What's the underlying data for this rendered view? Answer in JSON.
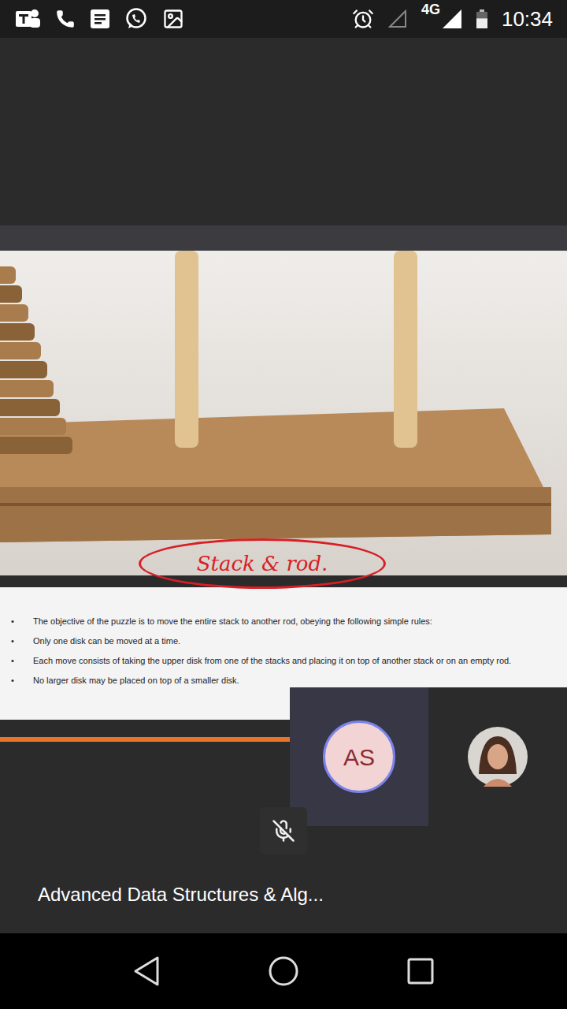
{
  "status_bar": {
    "time": "10:34",
    "network": "4G",
    "battery_level": 0.6
  },
  "slide": {
    "annotation": "Stack & rod.",
    "bullets": [
      {
        "marker": "•",
        "text": "The objective of the puzzle is to move the entire stack to another rod, obeying the following simple rules:"
      },
      {
        "marker": "•",
        "text": "Only one disk can be moved at a time."
      },
      {
        "marker": "•",
        "text": "Each move consists of taking the upper disk from one of the stacks and placing it on top of another stack or on an empty rod."
      },
      {
        "marker": "•",
        "text": "No larger disk may be placed on top of a smaller disk."
      }
    ]
  },
  "participants": [
    {
      "kind": "initials",
      "initials": "AS"
    },
    {
      "kind": "photo"
    }
  ],
  "mic": {
    "muted": true
  },
  "meeting": {
    "title": "Advanced Data Structures & Alg..."
  }
}
